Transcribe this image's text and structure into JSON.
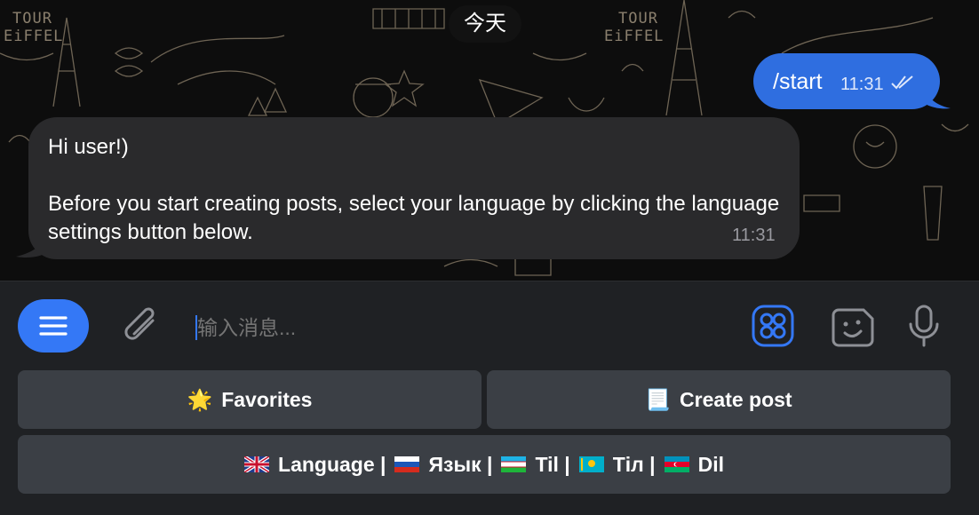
{
  "chat": {
    "date_separator": "今天",
    "outgoing": {
      "text": "/start",
      "time": "11:31",
      "status": "read-double-check"
    },
    "incoming": {
      "greeting": "Hi user!)",
      "body": "Before you start creating posts, select your language by clicking the language settings button below.",
      "time": "11:31"
    },
    "wallpaper_labels": {
      "tour_eiffel_1": "TOUR",
      "tour_eiffel_2": "EiFFEL"
    }
  },
  "composer": {
    "placeholder": "输入消息...",
    "menu_icon": "menu-icon",
    "attach_icon": "paperclip-icon",
    "apps_icon": "apps-grid-icon",
    "sticker_icon": "sticker-icon",
    "mic_icon": "microphone-icon"
  },
  "keyboard": {
    "favorites": {
      "emoji": "🌟",
      "label": "Favorites"
    },
    "create_post": {
      "emoji": "📃",
      "label": "Create post"
    },
    "language": {
      "parts": [
        "Language |",
        "Язык |",
        "Til |",
        "Тіл |",
        "Dil"
      ]
    }
  },
  "colors": {
    "accent": "#3478f6",
    "outgoing_bubble": "#2f6ee0",
    "incoming_bubble": "#2a2a2c",
    "composer_bg": "#1f2124",
    "keyboard_button": "#3b3f45"
  }
}
